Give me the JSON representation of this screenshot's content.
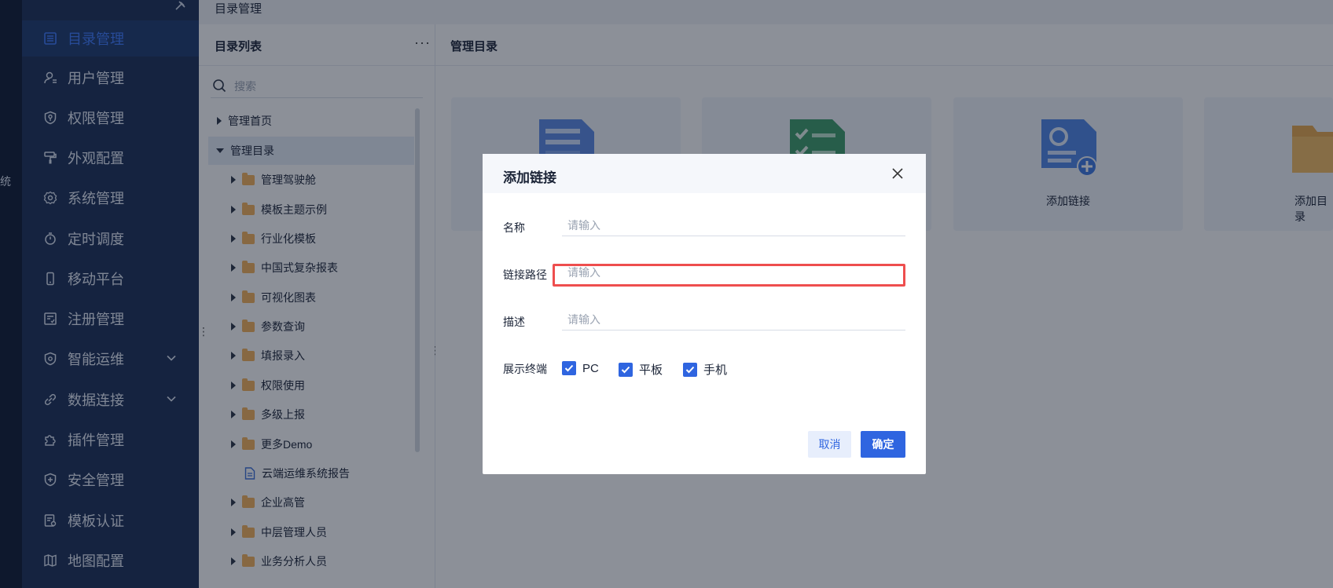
{
  "edge_text": "统",
  "breadcrumb": "目录管理",
  "sidebar": {
    "items": [
      {
        "label": "目录管理",
        "icon": "list-icon",
        "active": true
      },
      {
        "label": "用户管理",
        "icon": "user-icon"
      },
      {
        "label": "权限管理",
        "icon": "shield-key-icon"
      },
      {
        "label": "外观配置",
        "icon": "paint-roller-icon"
      },
      {
        "label": "系统管理",
        "icon": "gear-icon"
      },
      {
        "label": "定时调度",
        "icon": "stopwatch-icon"
      },
      {
        "label": "移动平台",
        "icon": "mobile-icon"
      },
      {
        "label": "注册管理",
        "icon": "register-icon"
      },
      {
        "label": "智能运维",
        "icon": "ops-icon",
        "expandable": true
      },
      {
        "label": "数据连接",
        "icon": "link-icon",
        "expandable": true
      },
      {
        "label": "插件管理",
        "icon": "puzzle-icon"
      },
      {
        "label": "安全管理",
        "icon": "shield-plus-icon"
      },
      {
        "label": "模板认证",
        "icon": "certificate-icon"
      },
      {
        "label": "地图配置",
        "icon": "map-icon"
      }
    ]
  },
  "dir_panel": {
    "title": "目录列表",
    "more": "···",
    "search_placeholder": "搜索",
    "tree": [
      {
        "label": "管理首页",
        "level": 0,
        "type": "node",
        "expanded": false
      },
      {
        "label": "管理目录",
        "level": 0,
        "type": "node",
        "expanded": true,
        "selected": true
      },
      {
        "label": "管理驾驶舱",
        "level": 1,
        "type": "folder"
      },
      {
        "label": "模板主题示例",
        "level": 1,
        "type": "folder"
      },
      {
        "label": "行业化模板",
        "level": 1,
        "type": "folder"
      },
      {
        "label": "中国式复杂报表",
        "level": 1,
        "type": "folder"
      },
      {
        "label": "可视化图表",
        "level": 1,
        "type": "folder"
      },
      {
        "label": "参数查询",
        "level": 1,
        "type": "folder"
      },
      {
        "label": "填报录入",
        "level": 1,
        "type": "folder"
      },
      {
        "label": "权限使用",
        "level": 1,
        "type": "folder"
      },
      {
        "label": "多级上报",
        "level": 1,
        "type": "folder"
      },
      {
        "label": "更多Demo",
        "level": 1,
        "type": "folder"
      },
      {
        "label": "云端运维系统报告",
        "level": 1,
        "type": "file"
      },
      {
        "label": "企业高管",
        "level": 1,
        "type": "folder"
      },
      {
        "label": "中层管理人员",
        "level": 1,
        "type": "folder"
      },
      {
        "label": "业务分析人员",
        "level": 1,
        "type": "folder"
      }
    ]
  },
  "content": {
    "title": "管理目录",
    "cards": [
      {
        "label": "",
        "icon": "template-icon"
      },
      {
        "label": "",
        "icon": "check-doc-icon"
      },
      {
        "label": "添加链接",
        "icon": "add-link-icon"
      },
      {
        "label": "添加目录",
        "icon": "folder-icon"
      }
    ]
  },
  "dialog": {
    "title": "添加链接",
    "fields": {
      "name_label": "名称",
      "name_placeholder": "请输入",
      "path_label": "链接路径",
      "path_placeholder": "请输入",
      "desc_label": "描述",
      "desc_placeholder": "请输入"
    },
    "terminal_label": "展示终端",
    "terminals": [
      {
        "label": "PC",
        "checked": true
      },
      {
        "label": "平板",
        "checked": true
      },
      {
        "label": "手机",
        "checked": true
      }
    ],
    "cancel_label": "取消",
    "confirm_label": "确定"
  },
  "colors": {
    "accent": "#2f65e0",
    "sidebar_bg": "#1b2f57",
    "highlight": "#ee4e4e"
  }
}
